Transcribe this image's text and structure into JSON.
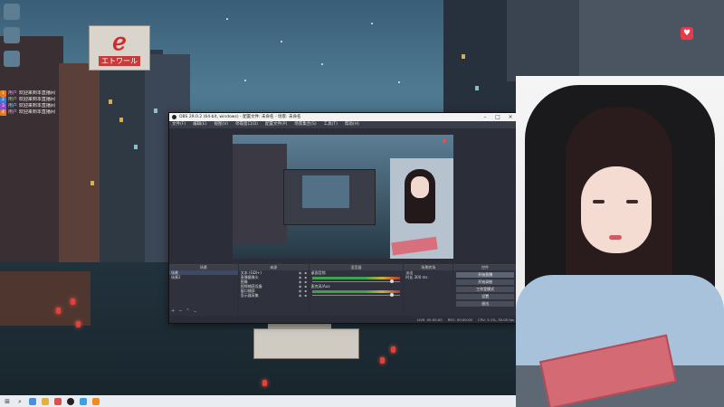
{
  "obs": {
    "title": "OBS 29.0.2 (64-bit, windows) - 配置文件: 未命名 - 场景: 未命名",
    "menu": [
      "文件(F)",
      "编辑(E)",
      "视图(V)",
      "停靠窗口(D)",
      "配置文件(P)",
      "场景集合(S)",
      "工具(T)",
      "帮助(H)"
    ],
    "docks": {
      "scenes": {
        "title": "场景",
        "items": [
          "场景",
          "场景2"
        ]
      },
      "sources": {
        "title": "来源",
        "items": [
          "文本 (GDI+)",
          "直播摄像头",
          "图像",
          "视频捕获设备",
          "窗口捕获",
          "显示器采集"
        ]
      },
      "mixer": {
        "title": "混音器",
        "channels": [
          "桌面音频",
          "麦克风/Aux"
        ]
      },
      "transitions": {
        "title": "场景转场",
        "type": "淡出",
        "duration_label": "时长",
        "duration": "300 ms"
      },
      "controls": {
        "title": "控件",
        "buttons": [
          "开始直播",
          "开始录制",
          "工作室模式",
          "设置",
          "退出"
        ]
      }
    },
    "status": [
      "LIVE: 00:00:00",
      "REC: 00:00:00",
      "CPU: 3.1%, 30.00 fps"
    ]
  },
  "chat": [
    {
      "badge": "1",
      "user": "用户",
      "text": "欢迎来到本直播间"
    },
    {
      "badge": "2",
      "user": "用户",
      "text": "欢迎来到本直播间"
    },
    {
      "badge": "3",
      "user": "用户",
      "text": "欢迎来到本直播间"
    },
    {
      "badge": "4",
      "user": "用户",
      "text": "欢迎来到本直播间"
    }
  ],
  "colors": {
    "accent_red": "#e83a4a",
    "obs_bg": "#2b2e38",
    "taskbar": "#e9edf2"
  }
}
